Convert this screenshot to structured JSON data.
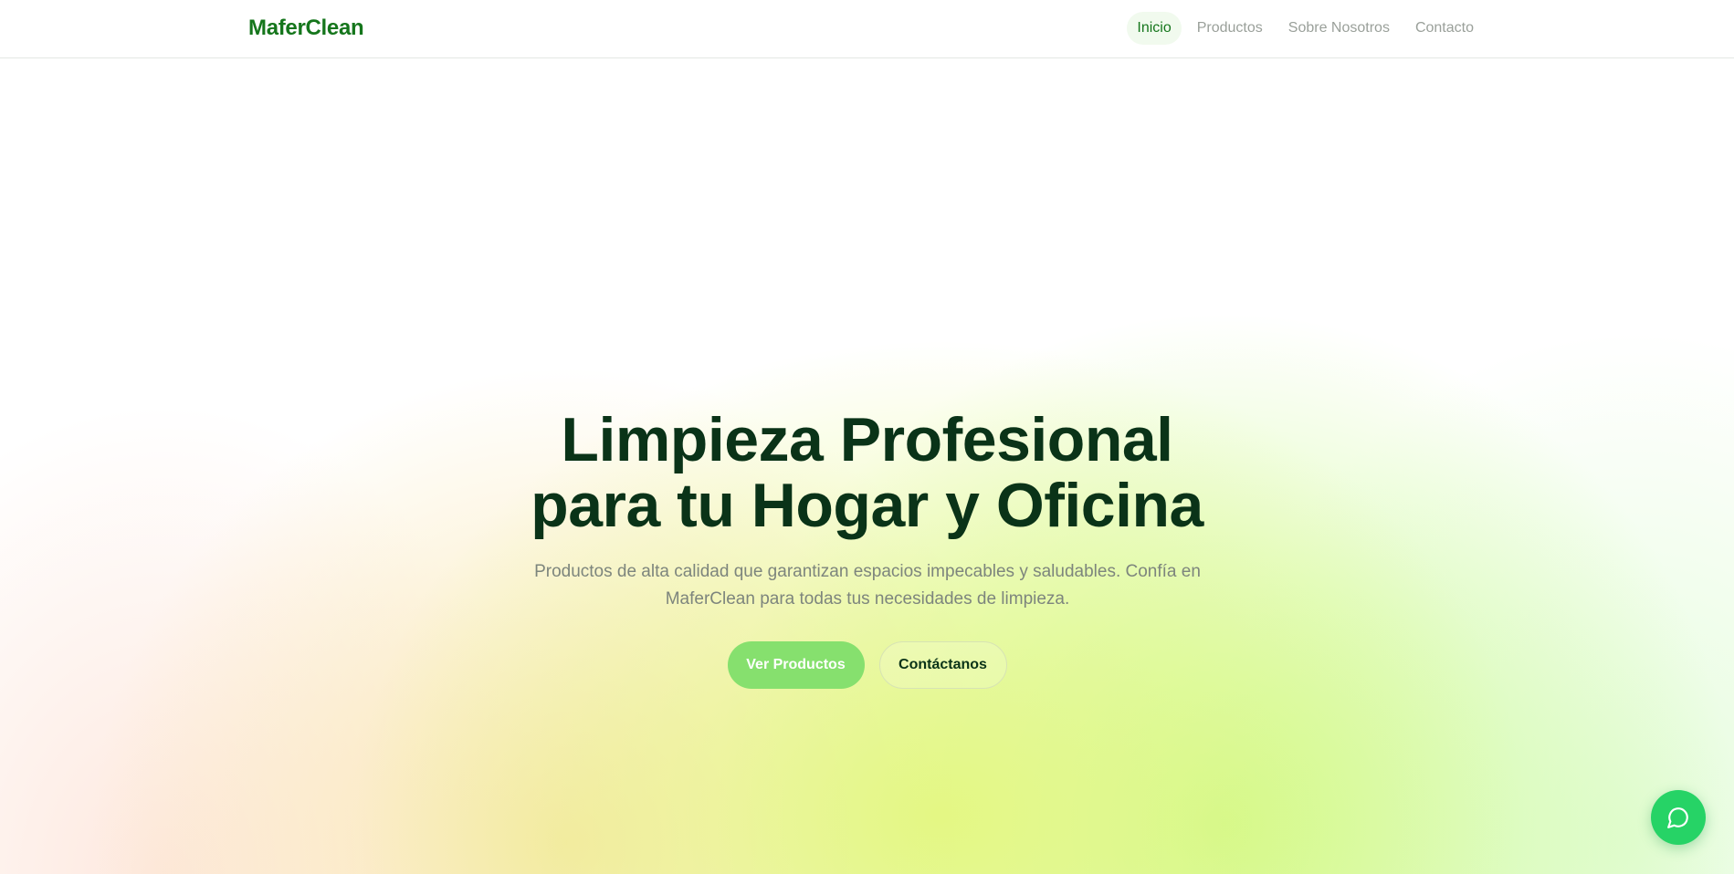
{
  "header": {
    "brand": "MaferClean",
    "nav": [
      {
        "label": "Inicio",
        "active": true
      },
      {
        "label": "Productos",
        "active": false
      },
      {
        "label": "Sobre Nosotros",
        "active": false
      },
      {
        "label": "Contacto",
        "active": false
      }
    ]
  },
  "hero": {
    "title_line1": "Limpieza Profesional",
    "title_line2": "para tu Hogar y Oficina",
    "subtitle": "Productos de alta calidad que garantizan espacios impecables y saludables. Confía en MaferClean para todas tus necesidades de limpieza.",
    "primary_button": "Ver Productos",
    "secondary_button": "Contáctanos"
  },
  "chat_button": {
    "icon": "chat-bubble-icon"
  },
  "colors": {
    "brand_green": "#15761c",
    "title_dark": "#0a3318",
    "primary_button": "#86e06e",
    "chat_button": "#26d366"
  }
}
